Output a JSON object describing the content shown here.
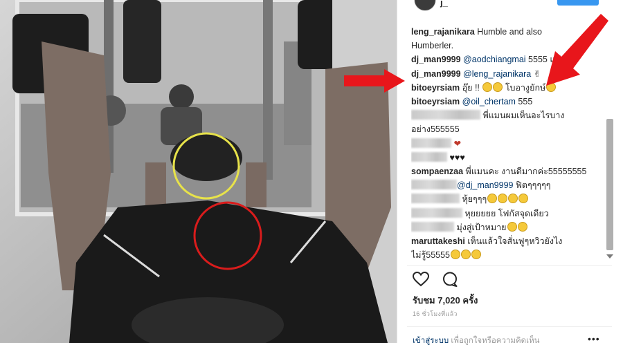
{
  "post": {
    "username": "j_",
    "views": "รับชม 7,020 ครั้ง",
    "time": "16 ชั่วโมงที่แล้ว",
    "login_link": "เข้าสู่ระบบ",
    "login_rest": " เพื่อถูกใจหรือความคิดเห็น"
  },
  "comments": [
    {
      "user": "leng_rajanikara",
      "text": " Humble and also",
      "cut": true
    },
    {
      "user": "",
      "text": "Humberler."
    },
    {
      "user": "dj_man9999",
      "mention": " @aodchiangmai",
      "text": " 5555 แม่นอน"
    },
    {
      "user": "dj_man9999",
      "mention": " @leng_rajanikara",
      "text": " ✌"
    },
    {
      "user": "bitoeyrsiam",
      "text": " อุ๊ย !! ",
      "emojis": 2,
      "text2": " โบอางูยักษ์",
      "emojis2": 1
    },
    {
      "user": "bitoeyrsiam",
      "mention": " @oil_chertam",
      "text": " 555"
    },
    {
      "blurred": 100,
      "text": " พี่แมนผมเห็นอะไรบาง"
    },
    {
      "user": "",
      "text": "อย่าง555555"
    },
    {
      "blurred": 58,
      "text": " ❤"
    },
    {
      "blurred": 52,
      "text": " ♥♥♥"
    },
    {
      "user": "sompaenzaa",
      "text": " พี่แมนคะ งานดีมากค่ะ55555555"
    },
    {
      "blurred": 66,
      "mention": "@dj_man9999",
      "text": " ฟิตๆๆๆๆๆ"
    },
    {
      "blurred": 70,
      "text": " หุ้ยๆๆๆ",
      "emojis": 4
    },
    {
      "blurred": 74,
      "text": " หุยยยยย โฟกัสจุดเดียว"
    },
    {
      "blurred": 62,
      "text": " มุ่งสู่เป้าหมาย",
      "emojis": 2
    },
    {
      "user": "maruttakeshi",
      "text": " เห็นแล้วใจสั่นฟูๆหวิวยังไง"
    },
    {
      "user": "",
      "text": "ไม่รู้55555",
      "emojis": 3
    }
  ],
  "icons": {
    "like": "heart-outline-icon",
    "comment": "speech-bubble-icon",
    "more": "ellipsis-icon"
  },
  "colors": {
    "annotation_red": "#e8161b",
    "yellow_circle": "#e7e24a",
    "red_circle": "#d91c1c"
  }
}
